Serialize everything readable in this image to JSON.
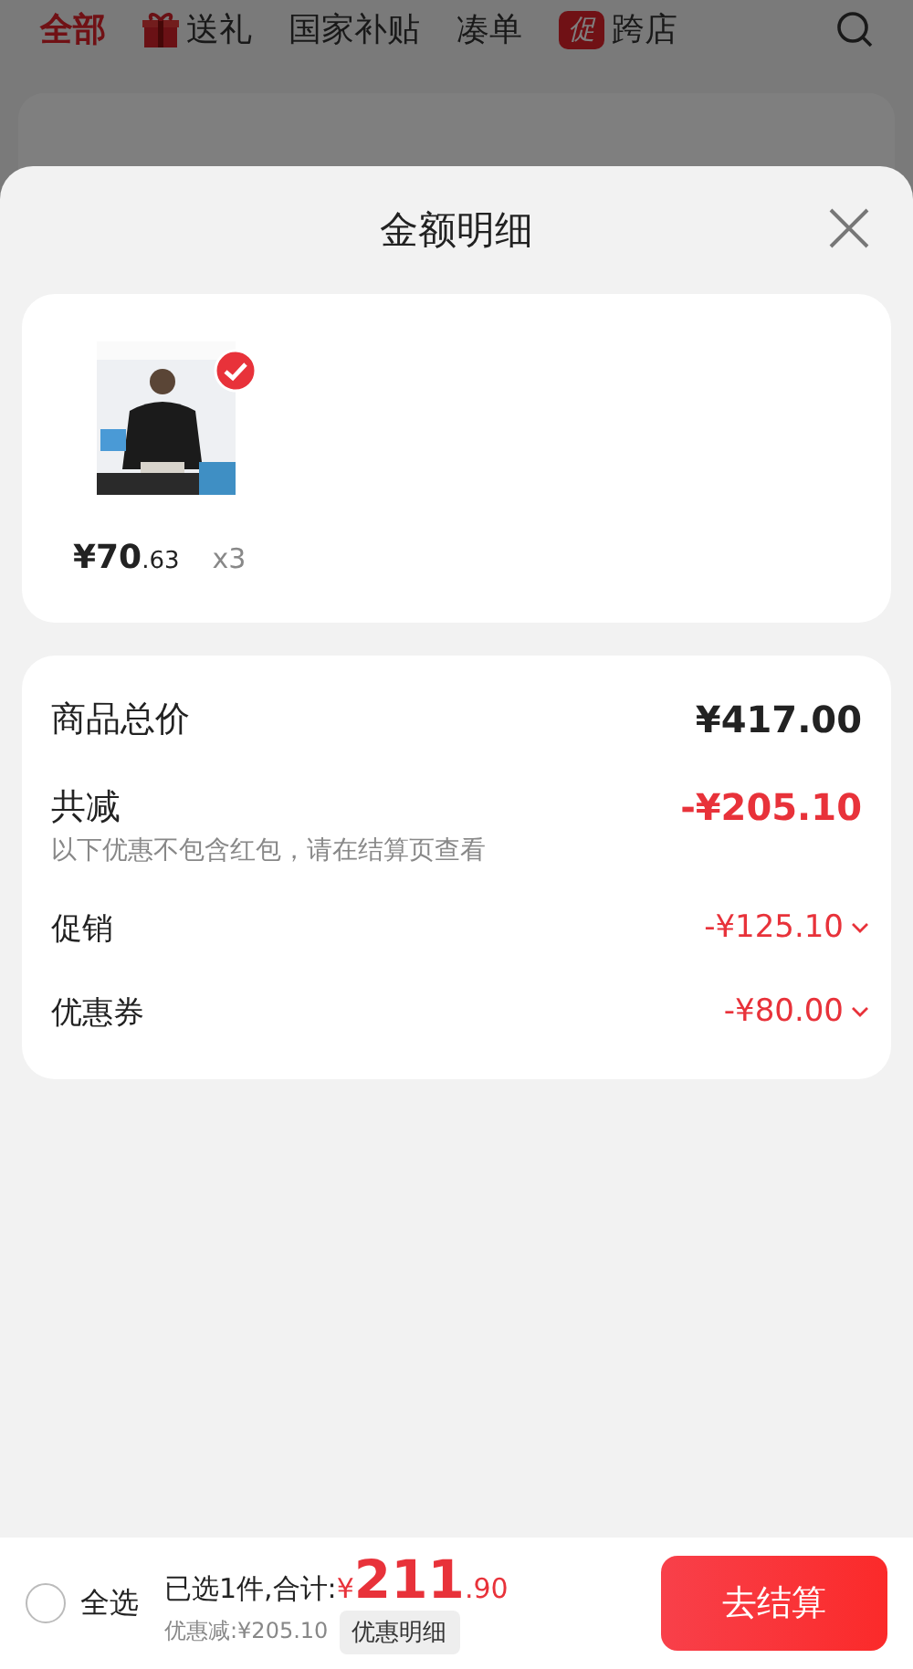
{
  "top_tabs": [
    {
      "label": "全部",
      "selected": true,
      "kind": "plain"
    },
    {
      "label": "送礼",
      "selected": false,
      "kind": "gift"
    },
    {
      "label": "国家补贴",
      "selected": false,
      "kind": "plain"
    },
    {
      "label": "凑单",
      "selected": false,
      "kind": "plain"
    },
    {
      "label": "跨店",
      "selected": false,
      "kind": "promo",
      "badge": "促"
    }
  ],
  "sheet": {
    "title": "金额明细",
    "products": [
      {
        "selected": true,
        "price_main": "¥70",
        "price_decimal": ".63",
        "quantity": "x3"
      }
    ],
    "summary": [
      {
        "kind": "total",
        "label": "商品总价",
        "amount": "¥417.00"
      },
      {
        "kind": "reduction",
        "label": "共减",
        "amount": "-¥205.10",
        "note": "以下优惠不包含红包，请在结算页查看"
      },
      {
        "kind": "discount",
        "label": "促销",
        "amount": "-¥125.10",
        "expanded": false
      },
      {
        "kind": "discount",
        "label": "优惠券",
        "amount": "-¥80.00",
        "expanded": false
      }
    ]
  },
  "bottom_bar": {
    "select_all": {
      "label": "全选",
      "checked": false
    },
    "selected_text": "已选1件,合计:",
    "currency": "¥",
    "total_main": "211",
    "total_decimal": ".90",
    "discount_text": "优惠减:¥205.10",
    "details_button": "优惠明细",
    "checkout_button": "去结算"
  }
}
